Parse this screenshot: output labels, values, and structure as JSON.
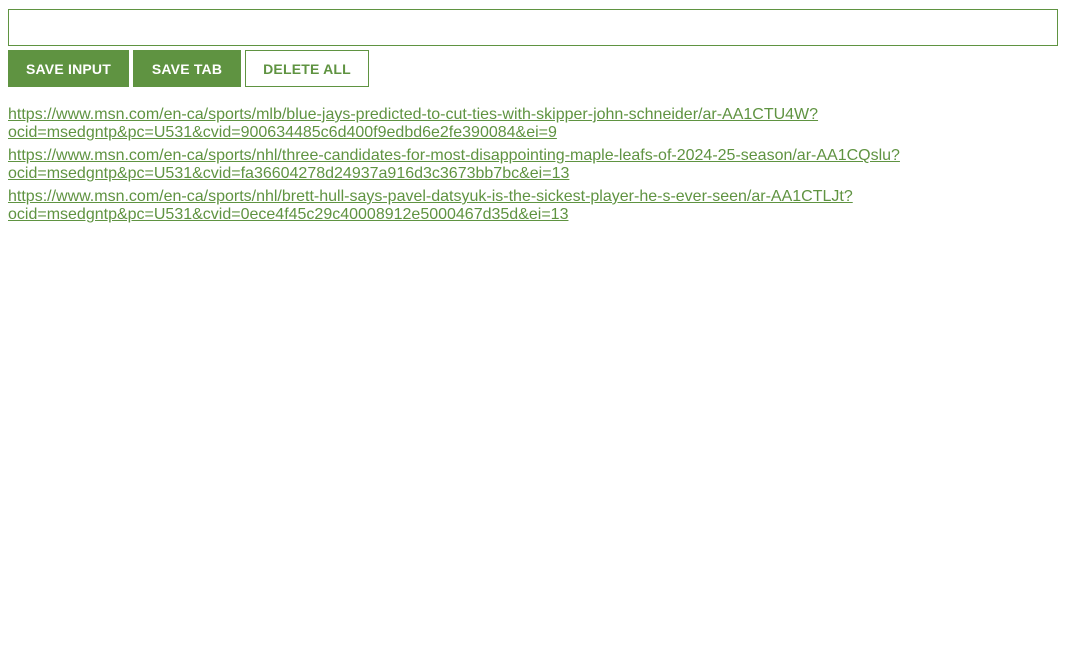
{
  "input": {
    "value": "",
    "placeholder": ""
  },
  "buttons": {
    "save_input": "SAVE INPUT",
    "save_tab": "SAVE TAB",
    "delete_all": "DELETE ALL"
  },
  "links": [
    {
      "line1": "https://www.msn.com/en-ca/sports/mlb/blue-jays-predicted-to-cut-ties-with-skipper-john-schneider/ar-AA1CTU4W?",
      "line2": "ocid=msedgntp&pc=U531&cvid=900634485c6d400f9edbd6e2fe390084&ei=9"
    },
    {
      "line1": "https://www.msn.com/en-ca/sports/nhl/three-candidates-for-most-disappointing-maple-leafs-of-2024-25-season/ar-AA1CQslu?",
      "line2": "ocid=msedgntp&pc=U531&cvid=fa36604278d24937a916d3c3673bb7bc&ei=13"
    },
    {
      "line1": "https://www.msn.com/en-ca/sports/nhl/brett-hull-says-pavel-datsyuk-is-the-sickest-player-he-s-ever-seen/ar-AA1CTLJt?",
      "line2": "ocid=msedgntp&pc=U531&cvid=0ece4f45c29c40008912e5000467d35d&ei=13"
    }
  ],
  "colors": {
    "accent": "#5f9341",
    "background": "#ffffff"
  }
}
